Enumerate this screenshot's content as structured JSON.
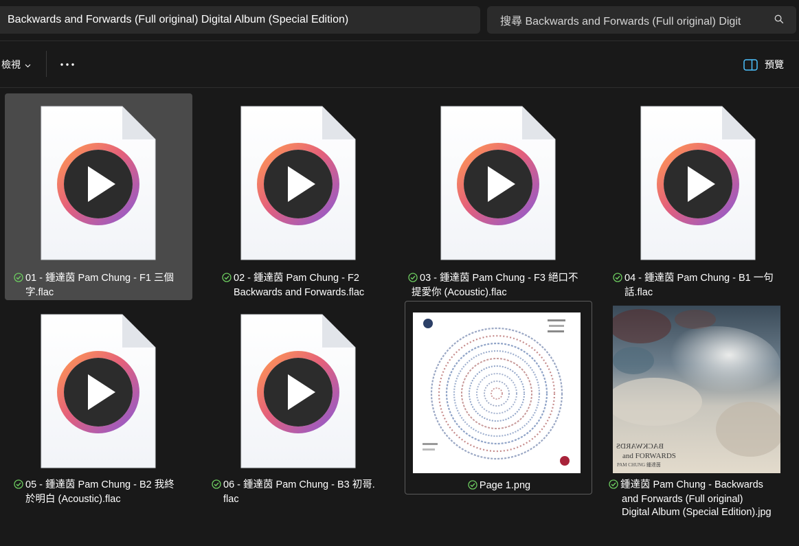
{
  "address": {
    "path": "Backwards and Forwards (Full original) Digital Album (Special Edition)"
  },
  "search": {
    "text": "搜尋 Backwards and Forwards (Full original) Digit"
  },
  "toolbar": {
    "view_label": "檢視",
    "preview_label": "預覽"
  },
  "files": [
    {
      "line1": "01 - 鍾達茵 Pam Chung - F1 三個",
      "line2": "字.flac",
      "type": "audio",
      "selected": true,
      "sync": "available"
    },
    {
      "line1": "02 - 鍾達茵 Pam Chung - F2",
      "line2": "Backwards and Forwards.flac",
      "type": "audio",
      "sync": "available"
    },
    {
      "line1": "03 - 鍾達茵 Pam Chung - F3 絕口不",
      "line2": "提愛你 (Acoustic).flac",
      "type": "audio",
      "sync": "available"
    },
    {
      "line1": "04 - 鍾達茵 Pam Chung - B1 一句",
      "line2": "話.flac",
      "type": "audio",
      "sync": "available"
    },
    {
      "line1": "05 - 鍾達茵 Pam Chung - B2 我終",
      "line2": "於明白 (Acoustic).flac",
      "type": "audio",
      "sync": "available"
    },
    {
      "line1": "06 - 鍾達茵 Pam Chung - B3 初哥.",
      "line2": "flac",
      "type": "audio",
      "sync": "available"
    },
    {
      "line1": "Page 1.png",
      "type": "image",
      "focused": true,
      "sync": "available"
    },
    {
      "line1": "鍾達茵 Pam Chung - Backwards",
      "line2": "and Forwards (Full original)",
      "line3": "Digital Album (Special Edition).jpg",
      "type": "image",
      "sync": "available"
    }
  ],
  "cover": {
    "line1": "BACKWARDS",
    "line2": "and FORWARDS",
    "line3": "PAM CHUNG 鍾達茵"
  },
  "colors": {
    "background": "#191919",
    "selection": "#4a4a4a",
    "sync_green": "#6ccb5f",
    "accent": "#4cc2ff"
  }
}
